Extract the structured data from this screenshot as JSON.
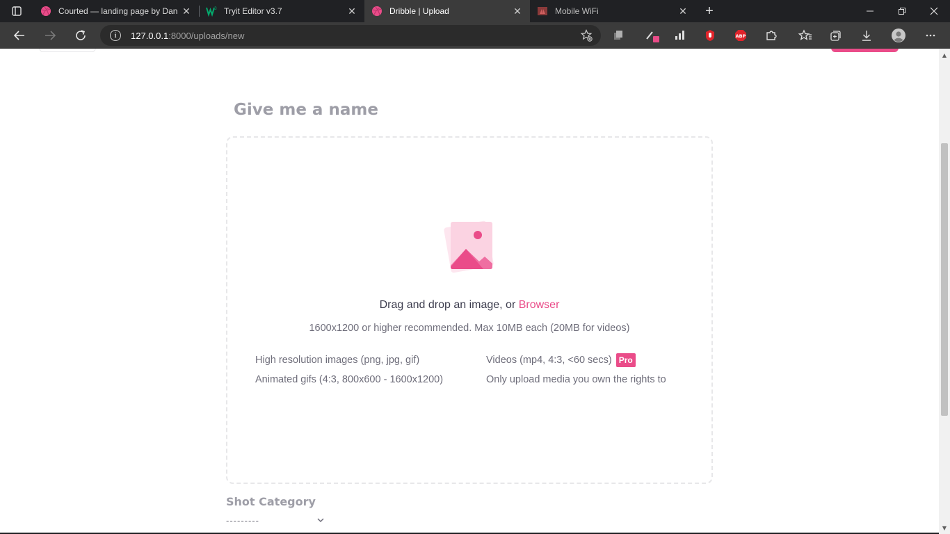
{
  "browser": {
    "tabs": [
      {
        "title": "Courted — landing page by Dan",
        "active": false,
        "favicon": "dribbble-icon"
      },
      {
        "title": "Tryit Editor v3.7",
        "active": false,
        "favicon": "w3schools-icon"
      },
      {
        "title": "Dribble | Upload",
        "active": true,
        "favicon": "dribbble-icon"
      },
      {
        "title": "Mobile WiFi",
        "active": false,
        "favicon": "huawei-icon"
      }
    ],
    "url_host": "127.0.0.1",
    "url_rest": ":8000/uploads/new"
  },
  "upload": {
    "name_placeholder": "Give me a name",
    "drop_text": "Drag and drop an image, or ",
    "drop_link": "Browser",
    "recommendation": "1600x1200 or higher recommended. Max 10MB each (20MB for videos)",
    "left_items": [
      "High resolution images (png, jpg, gif)",
      "Animated gifs (4:3, 800x600 - 1600x1200)"
    ],
    "right_items": [
      "Videos (mp4, 4:3, <60 secs)",
      "Only upload media you own the rights to"
    ],
    "pro_badge": "Pro"
  },
  "category": {
    "label": "Shot Category",
    "selected": "---------"
  },
  "colors": {
    "accent": "#ea4c89",
    "muted_text": "#9e9ea7",
    "body_text": "#6e6d7a"
  }
}
